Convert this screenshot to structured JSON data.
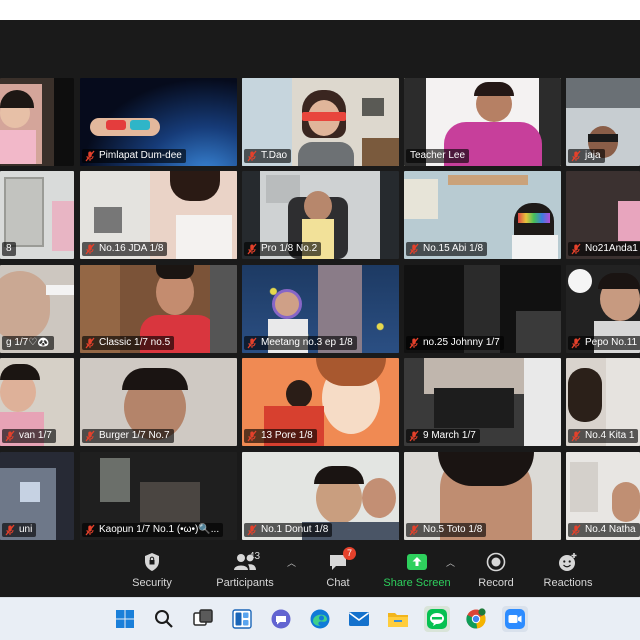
{
  "participants": [
    {
      "name": ""
    },
    {
      "name": "Pimlapat Dum-dee"
    },
    {
      "name": "T.Dao"
    },
    {
      "name": "Teacher Lee"
    },
    {
      "name": "jaja"
    },
    {
      "name": "8"
    },
    {
      "name": "No.16 JDA 1/8"
    },
    {
      "name": "Pro 1/8 No.2"
    },
    {
      "name": "No.15 Abi 1/8"
    },
    {
      "name": "No21Anda1"
    },
    {
      "name": "g 1/7♡🐼"
    },
    {
      "name": "Classic 1/7 no.5"
    },
    {
      "name": "Meetang no.3   ep 1/8"
    },
    {
      "name": "no.25 Johnny 1/7"
    },
    {
      "name": "Pepo No.11"
    },
    {
      "name": "van 1/7"
    },
    {
      "name": "Burger 1/7 No.7"
    },
    {
      "name": "13 Pore 1/8"
    },
    {
      "name": "9 March 1/7"
    },
    {
      "name": "No.4 Kita 1"
    },
    {
      "name": "uni"
    },
    {
      "name": "Kaopun 1/7 No.1 (•ω•)🔍..."
    },
    {
      "name": "No.1 Donut 1/8"
    },
    {
      "name": "No.5 Toto 1/8"
    },
    {
      "name": "No.4 Natha"
    }
  ],
  "toolbar": {
    "security": "Security",
    "participants": "Participants",
    "participants_count": "43",
    "chat": "Chat",
    "chat_badge": "7",
    "share_screen": "Share Screen",
    "record": "Record",
    "reactions": "Reactions"
  },
  "colors": {
    "active_speaker": "#c8dc3c",
    "share_green": "#2ed05d",
    "muted_red": "#e5412b",
    "toolbar_bg": "#1a1a1a"
  },
  "taskbar": [
    "windows-start-icon",
    "search-icon",
    "task-view-icon",
    "widgets-icon",
    "teams-chat-icon",
    "edge-icon",
    "mail-icon",
    "file-explorer-icon",
    "line-icon",
    "chrome-icon",
    "zoom-icon"
  ]
}
